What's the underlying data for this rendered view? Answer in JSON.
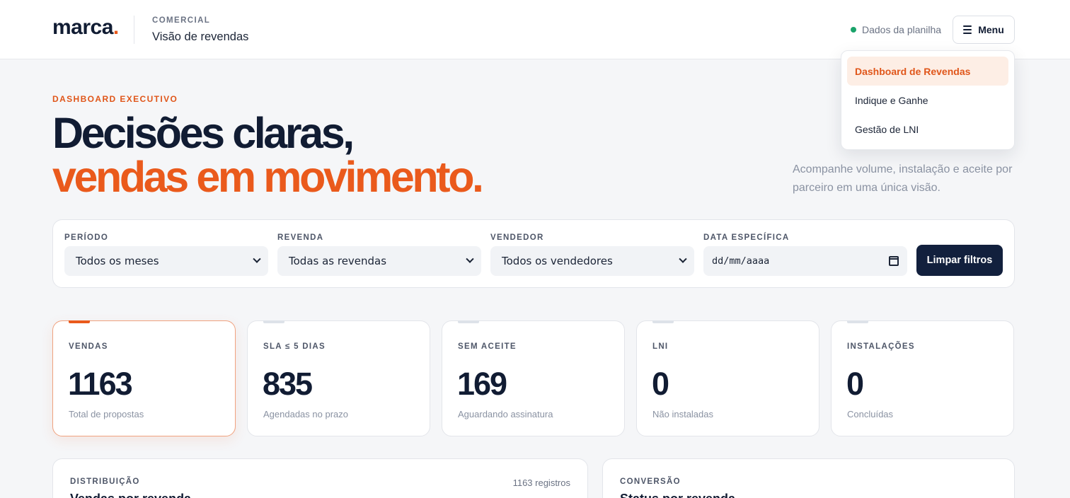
{
  "header": {
    "logo_text": "marca",
    "logo_dot": ".",
    "section": "COMERCIAL",
    "title": "Visão de revendas",
    "status_text": "Dados da planilha",
    "menu_label": "Menu"
  },
  "menu": {
    "items": [
      {
        "label": "Dashboard de Revendas",
        "active": true
      },
      {
        "label": "Indique e Ganhe",
        "active": false
      },
      {
        "label": "Gestão de LNI",
        "active": false
      }
    ]
  },
  "hero": {
    "eyebrow": "DASHBOARD EXECUTIVO",
    "line1": "Decisões claras,",
    "line2": "vendas em movimento.",
    "description": "Acompanhe volume, instalação e aceite por parceiro em uma única visão."
  },
  "filters": {
    "periodo": {
      "label": "PERÍODO",
      "value": "Todos os meses"
    },
    "revenda": {
      "label": "REVENDA",
      "value": "Todas as revendas"
    },
    "vendedor": {
      "label": "VENDEDOR",
      "value": "Todos os vendedores"
    },
    "data": {
      "label": "DATA ESPECÍFICA",
      "placeholder": "dd/mm/aaaa"
    },
    "clear_label": "Limpar filtros"
  },
  "kpis": [
    {
      "label": "VENDAS",
      "value": "1163",
      "sub": "Total de propostas",
      "active": true
    },
    {
      "label": "SLA ≤ 5 DIAS",
      "value": "835",
      "sub": "Agendadas no prazo",
      "active": false
    },
    {
      "label": "SEM ACEITE",
      "value": "169",
      "sub": "Aguardando assinatura",
      "active": false
    },
    {
      "label": "LNI",
      "value": "0",
      "sub": "Não instaladas",
      "active": false
    },
    {
      "label": "INSTALAÇÕES",
      "value": "0",
      "sub": "Concluídas",
      "active": false
    }
  ],
  "panels": {
    "distribuicao": {
      "label": "DISTRIBUIÇÃO",
      "count": "1163 registros",
      "title": "Vendas por revenda"
    },
    "conversao": {
      "label": "CONVERSÃO",
      "title": "Status por revenda"
    }
  },
  "colors": {
    "accent": "#ea5a1c",
    "navy": "#111c33",
    "status_green": "#1aa36a",
    "button_dark": "#12203d"
  }
}
